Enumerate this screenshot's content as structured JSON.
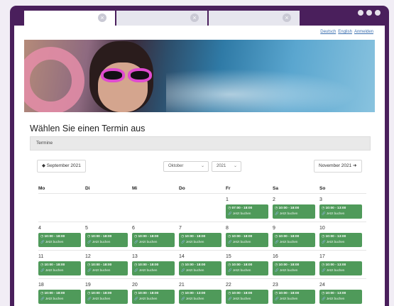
{
  "browser": {
    "tabs": [
      {
        "close": "×"
      },
      {
        "close": "×"
      },
      {
        "close": "×"
      }
    ]
  },
  "header": {
    "lang_de": "Deutsch",
    "lang_en": "English",
    "login": "Anmelden"
  },
  "page": {
    "title": "Wählen Sie einen Termin aus",
    "panel_title": "Termine"
  },
  "nav": {
    "prev": "◆ September 2021",
    "next": "November 2021 ➜",
    "month_select": "Oktober",
    "year_select": "2021",
    "chevron": "⌄"
  },
  "days": [
    "Mo",
    "Di",
    "Mi",
    "Do",
    "Fr",
    "Sa",
    "So"
  ],
  "weeks": [
    [
      {
        "day": "",
        "time": "",
        "book": ""
      },
      {
        "day": "",
        "time": "",
        "book": ""
      },
      {
        "day": "",
        "time": "",
        "book": ""
      },
      {
        "day": "",
        "time": "",
        "book": ""
      },
      {
        "day": "1",
        "time": "◷ 07:00 - 18:00",
        "book": "🔗 Jetzt buchen"
      },
      {
        "day": "2",
        "time": "◷ 10:00 - 18:00",
        "book": "🔗 Jetzt buchen"
      },
      {
        "day": "3",
        "time": "◷ 10:00 - 13:00",
        "book": "🔗 Jetzt buchen"
      }
    ],
    [
      {
        "day": "4",
        "time": "◷ 10:00 - 18:00",
        "book": "🔗 Jetzt buchen"
      },
      {
        "day": "5",
        "time": "◷ 10:00 - 18:00",
        "book": "🔗 Jetzt buchen"
      },
      {
        "day": "6",
        "time": "◷ 10:00 - 18:00",
        "book": "🔗 Jetzt buchen"
      },
      {
        "day": "7",
        "time": "◷ 10:00 - 18:00",
        "book": "🔗 Jetzt buchen"
      },
      {
        "day": "8",
        "time": "◷ 10:00 - 18:00",
        "book": "🔗 Jetzt buchen"
      },
      {
        "day": "9",
        "time": "◷ 10:00 - 18:00",
        "book": "🔗 Jetzt buchen"
      },
      {
        "day": "10",
        "time": "◷ 10:00 - 13:00",
        "book": "🔗 Jetzt buchen"
      }
    ],
    [
      {
        "day": "11",
        "time": "◷ 10:00 - 18:00",
        "book": "🔗 Jetzt buchen"
      },
      {
        "day": "12",
        "time": "◷ 10:00 - 18:00",
        "book": "🔗 Jetzt buchen"
      },
      {
        "day": "13",
        "time": "◷ 10:00 - 18:00",
        "book": "🔗 Jetzt buchen"
      },
      {
        "day": "14",
        "time": "◷ 10:00 - 18:00",
        "book": "🔗 Jetzt buchen"
      },
      {
        "day": "15",
        "time": "◷ 10:00 - 18:00",
        "book": "🔗 Jetzt buchen"
      },
      {
        "day": "16",
        "time": "◷ 10:00 - 18:00",
        "book": "🔗 Jetzt buchen"
      },
      {
        "day": "17",
        "time": "◷ 10:00 - 13:00",
        "book": "🔗 Jetzt buchen"
      }
    ],
    [
      {
        "day": "18",
        "time": "◷ 10:00 - 18:00",
        "book": "🔗 Jetzt buchen"
      },
      {
        "day": "19",
        "time": "◷ 10:00 - 18:00",
        "book": "🔗 Jetzt buchen"
      },
      {
        "day": "20",
        "time": "◷ 10:00 - 18:00",
        "book": "🔗 Jetzt buchen"
      },
      {
        "day": "21",
        "time": "◷ 10:00 - 13:00",
        "book": "🔗 Jetzt buchen"
      },
      {
        "day": "22",
        "time": "◷ 10:00 - 18:00",
        "book": "🔗 Jetzt buchen"
      },
      {
        "day": "23",
        "time": "◷ 10:00 - 18:00",
        "book": "🔗 Jetzt buchen"
      },
      {
        "day": "24",
        "time": "◷ 10:00 - 13:00",
        "book": "🔗 Jetzt buchen"
      }
    ]
  ],
  "colors": {
    "frame": "#4a1f5c",
    "slot_green": "#4f9a5a",
    "link_blue": "#3a6fb0"
  }
}
